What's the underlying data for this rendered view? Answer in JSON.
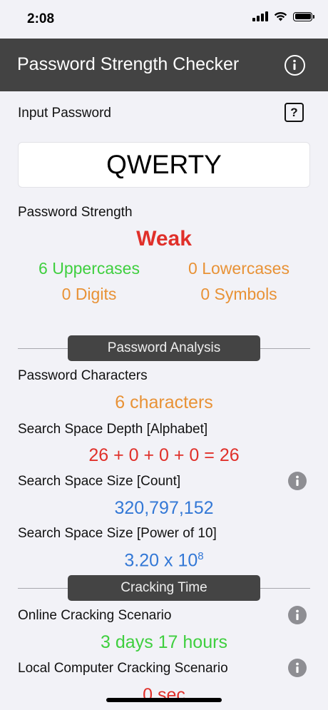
{
  "status": {
    "time": "2:08"
  },
  "nav": {
    "title": "Password Strength Checker",
    "info_icon": "info-circle-icon"
  },
  "input": {
    "label": "Input Password",
    "help_icon": "question-square-icon",
    "value": "QWERTY"
  },
  "strength": {
    "label": "Password Strength",
    "value": "Weak",
    "uppercases": "6 Uppercases",
    "lowercases": "0 Lowercases",
    "digits": "0 Digits",
    "symbols": "0 Symbols"
  },
  "analysis": {
    "header": "Password Analysis",
    "characters_label": "Password Characters",
    "characters_value": "6 characters",
    "depth_label": "Search Space Depth [Alphabet]",
    "depth_value": "26 + 0 + 0 + 0 = 26",
    "size_count_label": "Search Space Size [Count]",
    "size_count_value": "320,797,152",
    "size_power_label": "Search Space Size [Power of 10]",
    "size_power_mantissa": "3.20 x 10",
    "size_power_exponent": "8"
  },
  "cracking": {
    "header": "Cracking Time",
    "online_label": "Online Cracking Scenario",
    "online_value": "3 days 17 hours",
    "local_label": "Local Computer Cracking Scenario",
    "local_value": "0 sec"
  },
  "colors": {
    "nav_bg": "#434343",
    "weak": "#e0302a",
    "green": "#3fcf3f",
    "orange": "#e89236",
    "blue": "#3378d6"
  }
}
